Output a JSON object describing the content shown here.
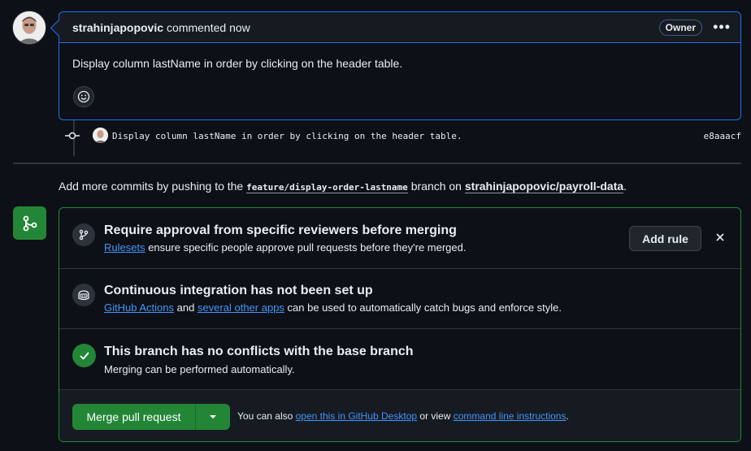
{
  "comment": {
    "author": "strahinjapopovic",
    "meta": "commented now",
    "badge": "Owner",
    "body": "Display column lastName in order by clicking on the header table."
  },
  "commit": {
    "message": "Display column lastName in order by clicking on the header table.",
    "sha": "e8aaacf"
  },
  "push_note": {
    "prefix": "Add more commits by pushing to the",
    "branch": "feature/display-order-lastname",
    "middle": "branch on",
    "repo": "strahinjapopovic/payroll-data",
    "suffix": "."
  },
  "merge_box": {
    "reviewers": {
      "title": "Require approval from specific reviewers before merging",
      "link": "Rulesets",
      "text": "ensure specific people approve pull requests before they're merged.",
      "button": "Add rule"
    },
    "ci": {
      "title": "Continuous integration has not been set up",
      "link1": "GitHub Actions",
      "and": "and",
      "link2": "several other apps",
      "text": "can be used to automatically catch bugs and enforce style."
    },
    "conflicts": {
      "title": "This branch has no conflicts with the base branch",
      "text": "Merging can be performed automatically."
    },
    "merge": {
      "button": "Merge pull request",
      "alt_prefix": "You can also",
      "alt_link1": "open this in GitHub Desktop",
      "alt_or": "or view",
      "alt_link2": "command line instructions",
      "alt_suffix": "."
    }
  },
  "colors": {
    "background": "#0d1117",
    "accent_blue": "#1f6feb",
    "success_green": "#238636",
    "link": "#4493f8"
  }
}
